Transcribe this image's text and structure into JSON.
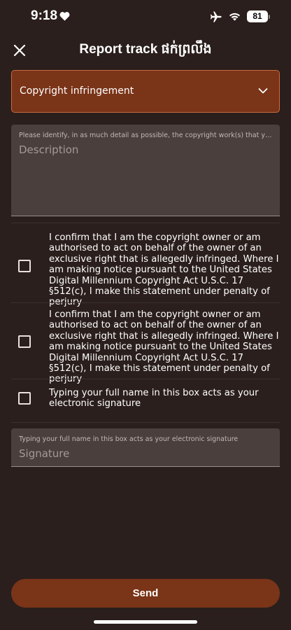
{
  "status_bar": {
    "time": "9:18",
    "battery": "81",
    "icons": [
      "heart-icon",
      "airplane-icon",
      "wifi-icon",
      "battery-icon"
    ]
  },
  "header": {
    "title": "Report track ផក់ព្រលឹង",
    "close_icon": "close-icon"
  },
  "form": {
    "reason_selected": "Copyright infringement",
    "description": {
      "label": "Please identify, in as much detail as possible, the copyright work(s) that you believe has been infringed",
      "placeholder": "Description"
    },
    "checkboxes": [
      {
        "label": "I confirm that I am the copyright owner or am authorised to act on behalf of the owner of an exclusive right that is allegedly infringed. Where I am making notice pursuant to the United States Digital Millennium Copyright Act U.S.C. 17 §512(c), I make this statement under penalty of perjury",
        "checked": false
      },
      {
        "label": "I confirm that I am the copyright owner or am authorised to act on behalf of the owner of an exclusive right that is allegedly infringed. Where I am making notice pursuant to the United States Digital Millennium Copyright Act U.S.C. 17 §512(c), I make this statement under penalty of perjury",
        "checked": false
      },
      {
        "label": "Typing your full name in this box acts as your electronic signature",
        "checked": false
      }
    ],
    "signature": {
      "label": "Typing your full name in this box acts as your electronic signature",
      "placeholder": "Signature"
    },
    "send_label": "Send"
  },
  "colors": {
    "background": "#2a1f1c",
    "accent": "#7a3418",
    "accent_border": "#c96a43",
    "field_bg": "#4a3f3c"
  }
}
